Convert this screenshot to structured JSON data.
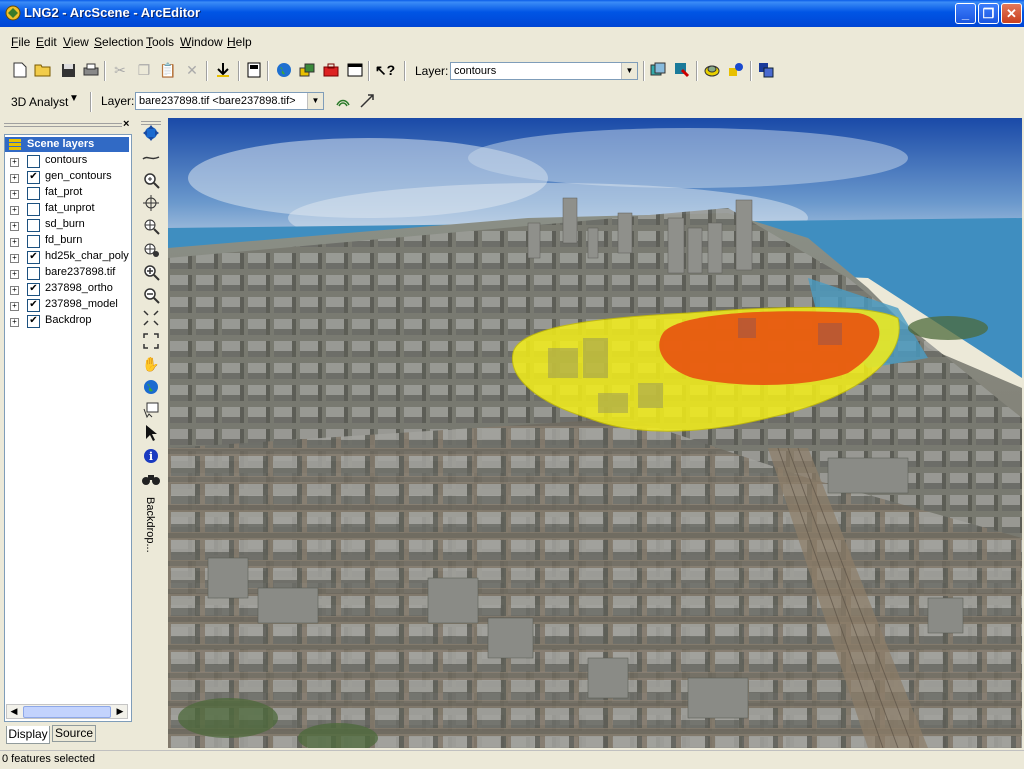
{
  "window": {
    "title": "LNG2 - ArcScene - ArcEditor"
  },
  "menu": [
    {
      "label": "File",
      "accel": "F",
      "rest": "ile"
    },
    {
      "label": "Edit",
      "accel": "E",
      "rest": "dit"
    },
    {
      "label": "View",
      "accel": "V",
      "rest": "iew"
    },
    {
      "label": "Selection",
      "accel": "S",
      "rest": "election"
    },
    {
      "label": "Tools",
      "accel": "T",
      "rest": "ools"
    },
    {
      "label": "Window",
      "accel": "W",
      "rest": "indow"
    },
    {
      "label": "Help",
      "accel": "H",
      "rest": "elp"
    }
  ],
  "standard_toolbar": {
    "layer_label": "Layer:",
    "layer_value": "contours",
    "icons": [
      "new-icon",
      "open-icon",
      "save-icon",
      "print-icon",
      "cut-icon",
      "copy-icon",
      "paste-icon",
      "delete-icon",
      "add-data-icon",
      "arctoolbox-icon",
      "globe-icon",
      "scene-properties-icon",
      "toolbox-icon",
      "command-line-icon",
      "whats-this-icon"
    ]
  },
  "analyst_toolbar": {
    "menu_label": "3D Analyst",
    "layer_label": "Layer:",
    "layer_value": "bare237898.tif <bare237898.tif>"
  },
  "toc": {
    "header": "Scene layers",
    "layers": [
      {
        "name": "contours",
        "checked": false
      },
      {
        "name": "gen_contours",
        "checked": true
      },
      {
        "name": "fat_prot",
        "checked": false
      },
      {
        "name": "fat_unprot",
        "checked": false
      },
      {
        "name": "sd_burn",
        "checked": false
      },
      {
        "name": "fd_burn",
        "checked": false
      },
      {
        "name": "hd25k_char_poly",
        "checked": true
      },
      {
        "name": "bare237898.tif",
        "checked": false
      },
      {
        "name": "237898_ortho",
        "checked": true
      },
      {
        "name": "237898_model",
        "checked": true
      },
      {
        "name": "Backdrop",
        "checked": true
      }
    ],
    "tabs": [
      "Display",
      "Source"
    ]
  },
  "vertical_tools": {
    "backdrop_label": "Backdrop..."
  },
  "status": {
    "text": "0 features selected"
  },
  "colors": {
    "title_blue": "#0055e5",
    "plume_yellow": "#f4ef1a",
    "plume_red": "#e8520f",
    "selection_blue": "#316ac5"
  }
}
